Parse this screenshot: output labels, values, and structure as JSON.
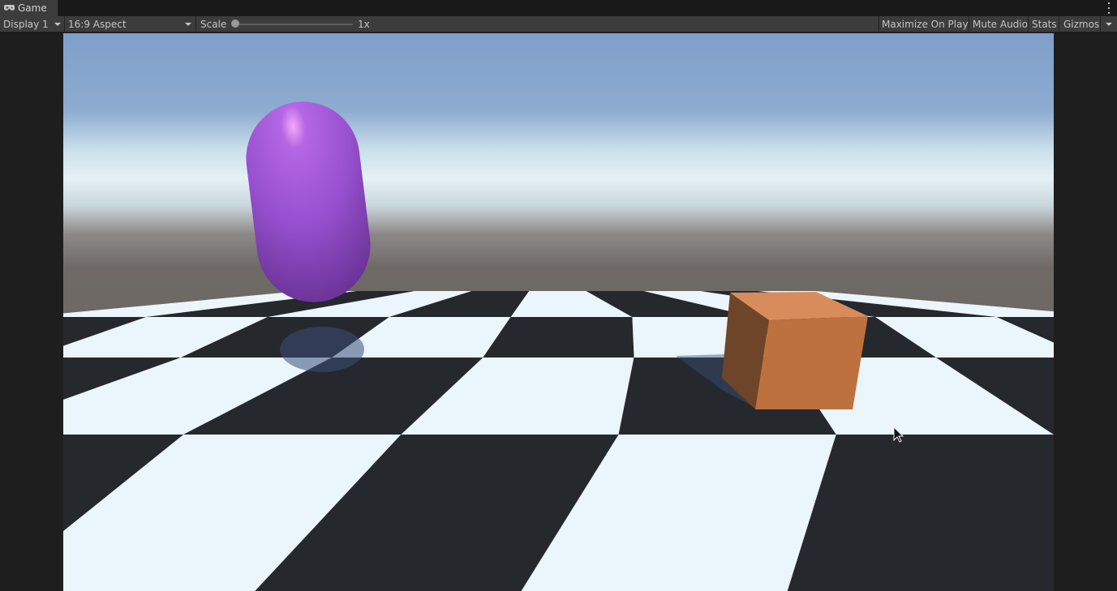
{
  "tab": {
    "title": "Game",
    "icon": "gamepad-icon"
  },
  "menu": {
    "icon": "kebab-menu-icon"
  },
  "toolbar": {
    "display": "Display 1",
    "aspect": "16:9 Aspect",
    "scale_label": "Scale",
    "scale_value": "1x",
    "scale_fraction": 0.0,
    "maximize": "Maximize On Play",
    "mute": "Mute Audio",
    "stats": "Stats",
    "gizmos": "Gizmos"
  },
  "scene": {
    "sky_top": "#7f9fca",
    "horizon": "#e6f1f5",
    "ground": "#6a6561",
    "tile_light": "#ebf5fc",
    "tile_dark": "#25282d",
    "capsule_color": "#9b52d6",
    "cube_color": "#c37a45",
    "cursor_icon": "mouse-pointer-icon"
  }
}
